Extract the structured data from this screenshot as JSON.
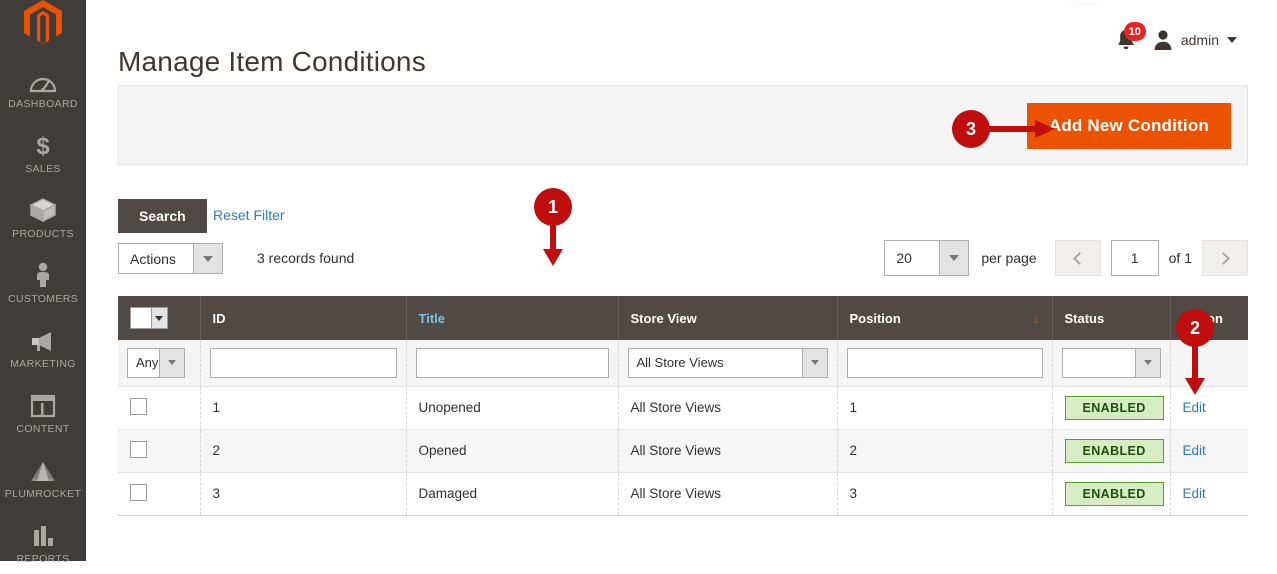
{
  "sidebar": {
    "logo_name": "magento-logo",
    "items": [
      {
        "label": "DASHBOARD",
        "icon": "dashboard-gauge-icon"
      },
      {
        "label": "SALES",
        "icon": "dollar-sign-icon"
      },
      {
        "label": "PRODUCTS",
        "icon": "box-icon"
      },
      {
        "label": "CUSTOMERS",
        "icon": "person-icon"
      },
      {
        "label": "MARKETING",
        "icon": "megaphone-icon"
      },
      {
        "label": "CONTENT",
        "icon": "layout-panel-icon"
      },
      {
        "label": "PLUMROCKET",
        "icon": "plumrocket-pyramid-icon"
      },
      {
        "label": "REPORTS",
        "icon": "bar-chart-icon"
      }
    ]
  },
  "header": {
    "title": "Manage Item Conditions",
    "ghost_message": "Cached",
    "notifications_count": "10",
    "user_name": "admin"
  },
  "page_actions": {
    "add_button_label": "Add New Condition"
  },
  "annotations": [
    {
      "number": "1"
    },
    {
      "number": "2"
    },
    {
      "number": "3"
    }
  ],
  "toolbar": {
    "search_label": "Search",
    "reset_filter_label": "Reset Filter",
    "actions_label": "Actions",
    "records_found": "3 records found",
    "per_page_value": "20",
    "per_page_label": "per page",
    "current_page": "1",
    "total_pages_label": "of 1"
  },
  "grid": {
    "columns": [
      {
        "label": "",
        "name": "select"
      },
      {
        "label": "ID",
        "name": "id"
      },
      {
        "label": "Title",
        "name": "title",
        "accent": true
      },
      {
        "label": "Store View",
        "name": "store-view"
      },
      {
        "label": "Position",
        "name": "position",
        "sorted": "desc"
      },
      {
        "label": "Status",
        "name": "status"
      },
      {
        "label": "Action",
        "name": "action"
      }
    ],
    "filters": {
      "select_any": "Any",
      "id_value": "",
      "title_value": "",
      "store_view_value": "All Store Views",
      "position_value": "",
      "status_value": ""
    },
    "rows": [
      {
        "id": "1",
        "title": "Unopened",
        "store_view": "All Store Views",
        "position": "1",
        "status": "ENABLED",
        "action": "Edit"
      },
      {
        "id": "2",
        "title": "Opened",
        "store_view": "All Store Views",
        "position": "2",
        "status": "ENABLED",
        "action": "Edit"
      },
      {
        "id": "3",
        "title": "Damaged",
        "store_view": "All Store Views",
        "position": "3",
        "status": "ENABLED",
        "action": "Edit"
      }
    ]
  },
  "colors": {
    "sidebar_bg": "#403c39",
    "accent_orange": "#eb5202",
    "header_row_bg": "#514943",
    "link_blue": "#2b7dbf",
    "annotation_red": "#c00d0d",
    "badge_red": "#e22626",
    "enabled_green_bg": "#d5ecc4",
    "enabled_green_border": "#5c9b2e"
  }
}
